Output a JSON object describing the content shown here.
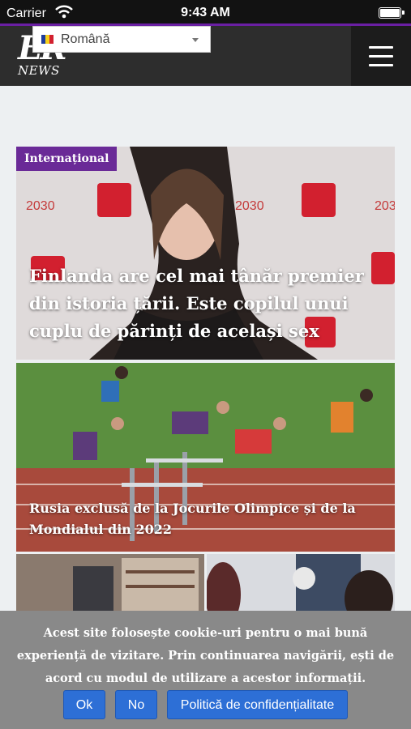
{
  "status_bar": {
    "carrier": "Carrier",
    "time": "9:43 AM"
  },
  "header": {
    "logo_mark": "ER",
    "logo_sub": "NEWS",
    "language": "Română"
  },
  "articles": [
    {
      "category": "Internațional",
      "title": "Finlanda are cel mai tânăr premier din istoria țării. Este copilul unui cuplu de părinți de același sex"
    },
    {
      "title": "Rusia exclusă de la Jocurile Olimpice și de la Mondialul din 2022"
    }
  ],
  "cookie_banner": {
    "message": "Acest site folosește cookie-uri pentru o mai bună experiență de vizitare. Prin continuarea navigării, ești de acord cu modul de utilizare a acestor informații.",
    "ok_label": "Ok",
    "no_label": "No",
    "policy_label": "Politică de confidențialitate"
  },
  "colors": {
    "accent": "#6a2a97",
    "button": "#2d6fd6",
    "header": "#2d2d2d"
  }
}
